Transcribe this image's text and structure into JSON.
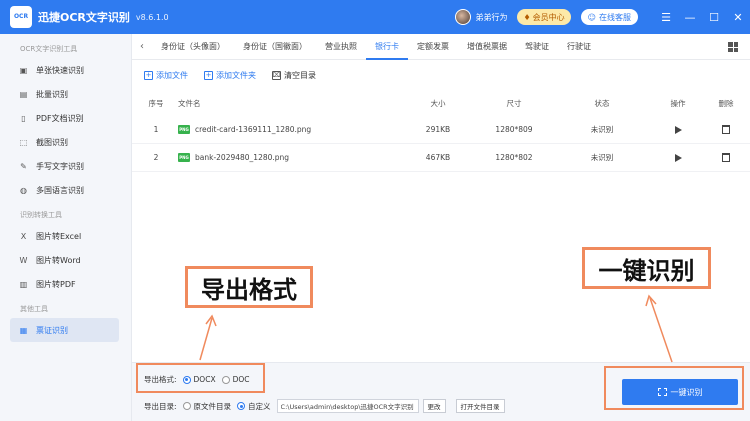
{
  "titlebar": {
    "logo_text": "OCR",
    "title": "迅捷OCR文字识别",
    "version": "v8.6.1.0",
    "username": "弟弟行为",
    "vip_label": "会员中心",
    "service_label": "在线客服",
    "menu_glyph": "☰",
    "min_glyph": "—",
    "max_glyph": "☐",
    "close_glyph": "✕"
  },
  "sidebar": {
    "sections": [
      {
        "title": "OCR文字识别工具",
        "items": [
          {
            "label": "单张快速识别",
            "icon": "image-icon"
          },
          {
            "label": "批量识别",
            "icon": "batch-icon"
          },
          {
            "label": "PDF文档识别",
            "icon": "pdf-icon"
          },
          {
            "label": "截图识别",
            "icon": "screenshot-icon"
          },
          {
            "label": "手写文字识别",
            "icon": "handwrite-icon"
          },
          {
            "label": "多国语言识别",
            "icon": "globe-icon"
          }
        ]
      },
      {
        "title": "识别转换工具",
        "items": [
          {
            "label": "图片转Excel",
            "icon": "excel-icon"
          },
          {
            "label": "图片转Word",
            "icon": "word-icon"
          },
          {
            "label": "图片转PDF",
            "icon": "pdf-convert-icon"
          }
        ]
      },
      {
        "title": "其他工具",
        "items": [
          {
            "label": "票证识别",
            "icon": "ticket-icon",
            "active": true
          }
        ]
      }
    ]
  },
  "tabs": {
    "back_glyph": "‹",
    "items": [
      "身份证（头像面）",
      "身份证（国徽面）",
      "营业执照",
      "银行卡",
      "定额发票",
      "增值税票据",
      "驾驶证",
      "行驶证"
    ],
    "active_index": 3
  },
  "toolbar": {
    "add_file": "添加文件",
    "add_folder": "添加文件夹",
    "clear_list": "清空目录"
  },
  "table": {
    "headers": {
      "no": "序号",
      "name": "文件名",
      "size": "大小",
      "dim": "尺寸",
      "status": "状态",
      "op": "操作",
      "del": "删除"
    },
    "file_badge": "PNG",
    "rows": [
      {
        "no": "1",
        "name": "credit-card-1369111_1280.png",
        "size": "291KB",
        "dim": "1280*809",
        "status": "未识别"
      },
      {
        "no": "2",
        "name": "bank-2029480_1280.png",
        "size": "467KB",
        "dim": "1280*802",
        "status": "未识别"
      }
    ]
  },
  "bottom": {
    "format_label": "导出格式:",
    "format_options": [
      "DOCX",
      "DOC"
    ],
    "format_selected": "DOCX",
    "dir_label": "导出目录:",
    "dir_options": [
      "原文件目录",
      "自定义"
    ],
    "dir_selected": "自定义",
    "path_value": "C:\\Users\\admin\\desktop\\迅捷OCR文字识别",
    "change_label": "更改",
    "open_dir_label": "打开文件目录",
    "recognize_label": "一键识别"
  },
  "annotations": {
    "format_callout": "导出格式",
    "recognize_callout": "一键识别",
    "accent_color": "#f08a5d"
  },
  "colors": {
    "brand": "#2f7bf0",
    "sidebar_bg": "#f4f6fa"
  }
}
